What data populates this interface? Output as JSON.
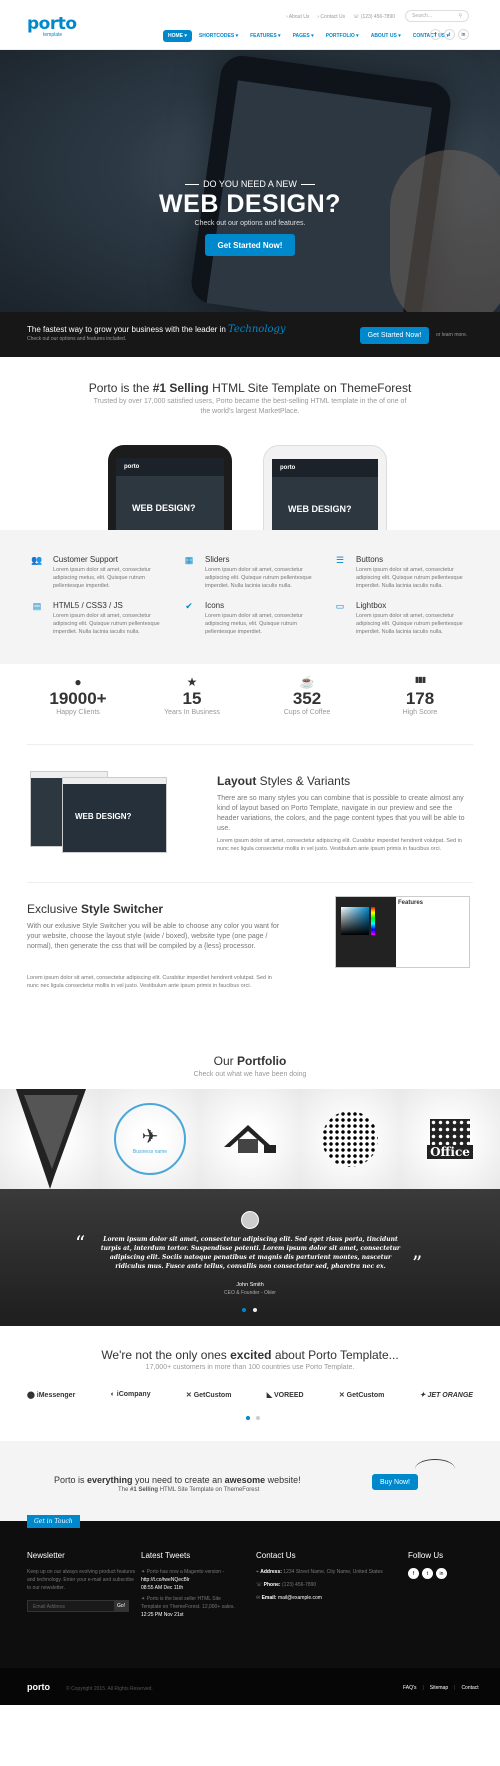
{
  "header": {
    "logo": "porto",
    "logo_sub": "template",
    "top_links": [
      "About Us",
      "Contact Us",
      "(123) 456-7890"
    ],
    "search_placeholder": "Search...",
    "nav": [
      "HOME",
      "SHORTCODES",
      "FEATURES",
      "PAGES",
      "PORTFOLIO",
      "ABOUT US",
      "CONTACT US"
    ],
    "social": [
      "f",
      "t",
      "in"
    ]
  },
  "hero": {
    "pre_title": "DO YOU NEED A NEW",
    "title": "WEB DESIGN?",
    "subtitle": "Check out our options and features.",
    "button": "Get Started Now!"
  },
  "cta": {
    "text": "The fastest way to grow your business with the leader in",
    "script": "Technology",
    "sub": "Check out our options and features included.",
    "button": "Get Started Now!",
    "or": "or learn more."
  },
  "intro": {
    "title_pre": "Porto is the ",
    "title_bold": "#1 Selling",
    "title_post": " HTML Site Template on ThemeForest",
    "text": "Trusted by over 17,000 satisfied users, Porto became the best-selling HTML template in the of one of the world's largest MarketPlace."
  },
  "phones": {
    "logo": "porto",
    "text": "WEB DESIGN?"
  },
  "features": [
    {
      "icon": "users-icon",
      "glyph": "👥",
      "title": "Customer Support",
      "text": "Lorem ipsum dolor sit amet, consectetur adipiscing metus, elit. Quisque rutrum pellentesque imperdiet."
    },
    {
      "icon": "film-icon",
      "glyph": "▦",
      "title": "Sliders",
      "text": "Lorem ipsum dolor sit amet, consectetur adipiscing elit. Quisque rutrum pellentesque imperdiet. Nulla lacinia iaculis nulla."
    },
    {
      "icon": "bars-icon",
      "glyph": "☰",
      "title": "Buttons",
      "text": "Lorem ipsum dolor sit amet, consectetur adipiscing elit. Quisque rutrum pellentesque imperdiet. Nulla lacinia iaculis nulla."
    },
    {
      "icon": "file-icon",
      "glyph": "▤",
      "title": "HTML5 / CSS3 / JS",
      "text": "Lorem ipsum dolor sit amet, consectetur adipiscing elit. Quisque rutrum pellentesque imperdiet. Nulla lacinia iaculis nulla."
    },
    {
      "icon": "check-icon",
      "glyph": "✔",
      "title": "Icons",
      "text": "Lorem ipsum dolor sit amet, consectetur adipiscing metus, elit. Quisque rutrum pellentesque imperdiet."
    },
    {
      "icon": "desktop-icon",
      "glyph": "▭",
      "title": "Lightbox",
      "text": "Lorem ipsum dolor sit amet, consectetur adipiscing elit. Quisque rutrum pellentesque imperdiet. Nulla lacinia iaculis nulla."
    }
  ],
  "stats": [
    {
      "icon": "user-icon",
      "glyph": "●",
      "value": "19000+",
      "label": "Happy Clients"
    },
    {
      "icon": "star-icon",
      "glyph": "★",
      "value": "15",
      "label": "Years In Business"
    },
    {
      "icon": "coffee-icon",
      "glyph": "☕",
      "value": "352",
      "label": "Cups of Coffee"
    },
    {
      "icon": "chart-icon",
      "glyph": "▮▮▮",
      "value": "178",
      "label": "High Score"
    }
  ],
  "layout": {
    "title_bold": "Layout",
    "title_rest": " Styles & Variants",
    "text": "There are so many styles you can combine that is possible to create almost any kind of layout based on Porto Template, navigate in our preview and see the header variations, the colors, and the page content types that you will be able to use.",
    "text2": "Lorem ipsum dolor sit amet, consectetur adipiscing elit. Curabitur imperdiet hendrerit volutpat. Sed in nunc nec ligula consectetur mollis in vel justo. Vestibulum ante ipsum primis in faucibus orci.",
    "mock_title": "WEB DESIGN?"
  },
  "switcher": {
    "title_pre": "Exclusive ",
    "title_bold": "Style Switcher",
    "text": "With our exlusive Style Switcher you will be able to choose any color you want for your website, choose the layout style (wide / boxed), website type (one page / normal), then generate the css that will be compiled by a {less} processor.",
    "text2": "Lorem ipsum dolor sit amet, consectetur adipiscing elit. Curabitur imperdiet hendrerit volutpat. Sed in nunc nec ligula consectetur mollis in vel justo. Vestibulum ante ipsum primis in faucibus orci.",
    "panel_label": "Features"
  },
  "portfolio": {
    "title_pre": "Our ",
    "title_bold": "Portfolio",
    "subtitle": "Check out what we have been doing",
    "items": [
      "Business name",
      "Office"
    ]
  },
  "testimonial": {
    "quote": "Lorem ipsum dolor sit amet, consectetur adipiscing elit. Sed eget risus porta, tincidunt turpis at, interdum tortor. Suspendisse potenti. Lorem ipsum dolor sit amet, consectetur adipiscing elit. Sociis natoque penatibus et magnis dis parturient montes, nascetur ridiculus mus. Fusce ante tellus, convallis non consectetur sed, pharetra nec ex.",
    "author": "John Smith",
    "role": "CEO & Founder - Okler"
  },
  "clients": {
    "title_pre": "We're not the only ones ",
    "title_bold": "excited",
    "title_post": " about Porto Template...",
    "subtitle": "17,000+ customers in more than 100 countries use Porto Template.",
    "logos": [
      "iMessenger",
      "iCompany",
      "GetCustom",
      "VOREED",
      "GetCustom",
      "JET ORANGE"
    ]
  },
  "buy": {
    "title_pre": "Porto is ",
    "title_b1": "everything",
    "title_mid": " you need to create an ",
    "title_b2": "awesome",
    "title_post": " website!",
    "sub_pre": "The ",
    "sub_bold": "#1 Selling",
    "sub_post": " HTML Site Template on ThemeForest",
    "button": "Buy Now!"
  },
  "footer": {
    "get_in_touch": "Get in Touch",
    "newsletter_title": "Newsletter",
    "newsletter_text": "Keep up on our always evolving product features and technology. Enter your e-mail and subscribe to our newsletter.",
    "email_placeholder": "Email Address",
    "go": "Go!",
    "tweets_title": "Latest Tweets",
    "tweet1": "Porto has now a Magento version -",
    "tweet1_link": "http://t.co/tweNQecBlr",
    "tweet1_time": "08:55 AM Dec 11th",
    "tweet2": "Porto is the best seller HTML Site Template on ThemeForest. 12,000+ sales.",
    "tweet2_time": "12:25 PM Nov 21st",
    "contact_title": "Contact Us",
    "address_label": "Address:",
    "address": "1234 Street Name, City Name, United States",
    "phone_label": "Phone:",
    "phone": "(123) 456-7890",
    "email_label": "Email:",
    "email": "mail@example.com",
    "follow_title": "Follow Us",
    "social": [
      "f",
      "t",
      "in"
    ]
  },
  "copyright": {
    "logo": "porto",
    "text": "© Copyright 2015. All Rights Reserved.",
    "links": [
      "FAQ's",
      "Sitemap",
      "Contact"
    ]
  },
  "colors": {
    "accent": "#0088cc",
    "dark": "#171717",
    "footer": "#0e0e0e"
  }
}
